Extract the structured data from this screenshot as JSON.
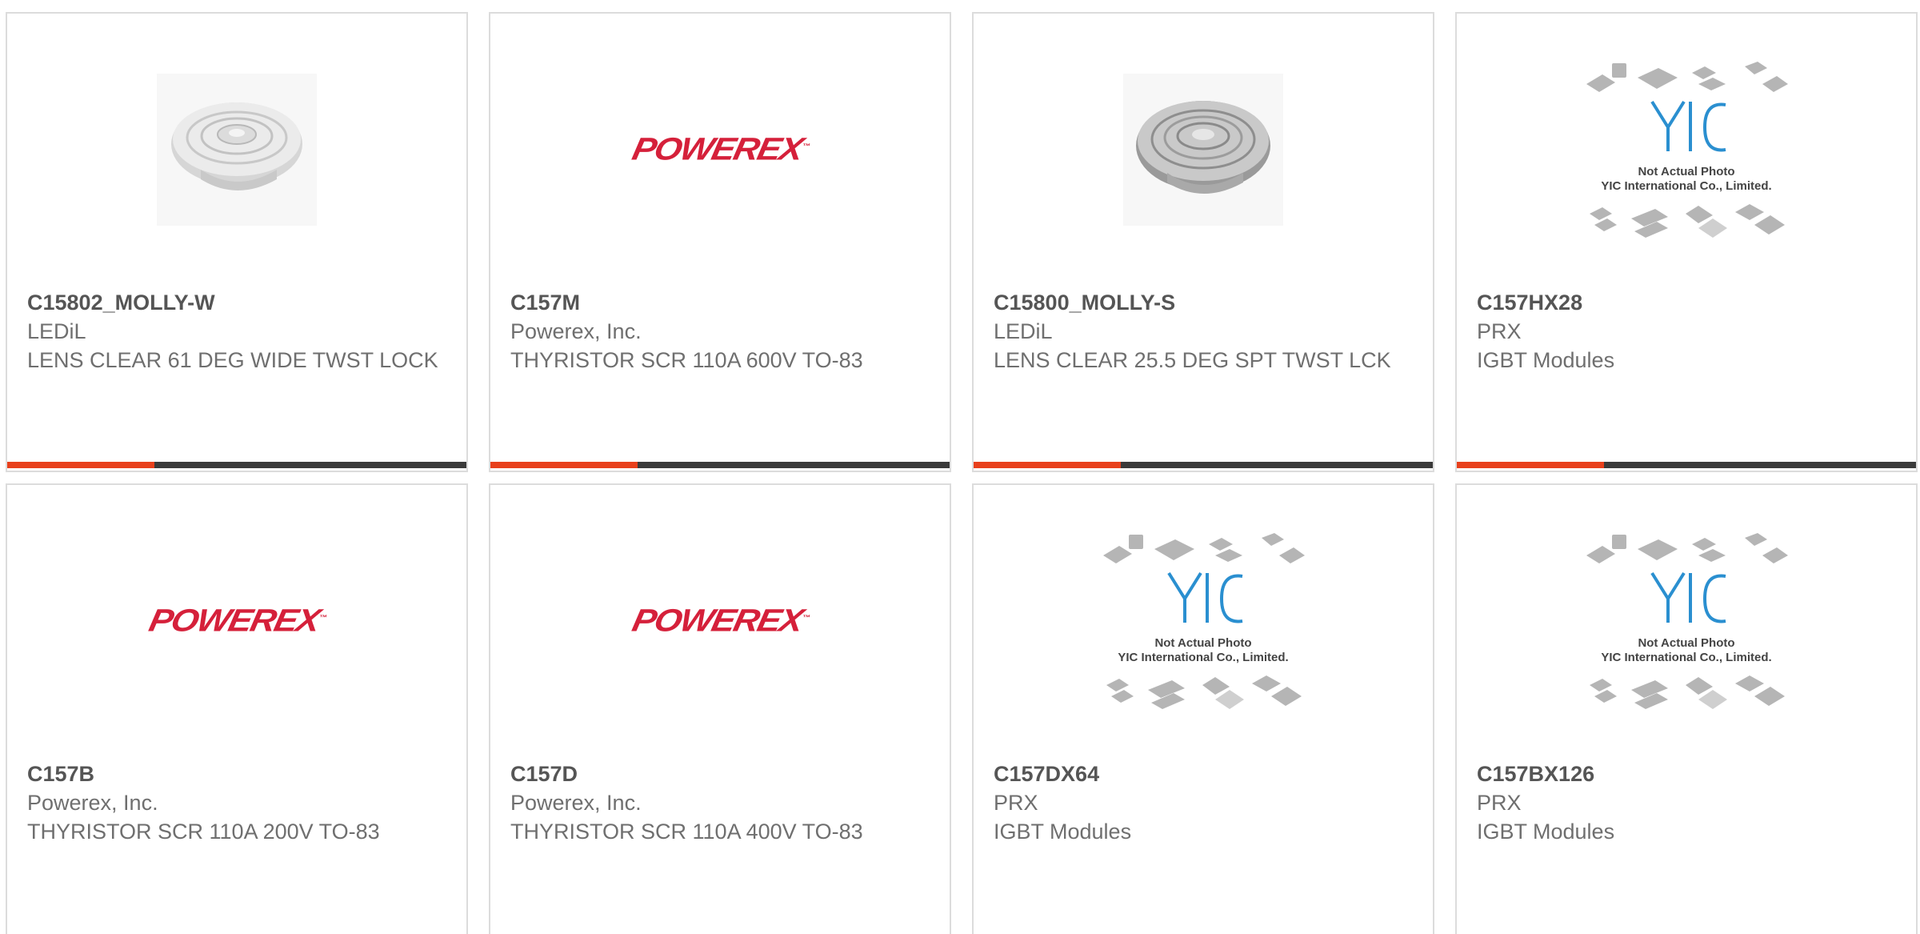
{
  "products": [
    {
      "part": "C15802_MOLLY-W",
      "manufacturer": "LEDiL",
      "description": "LENS CLEAR 61 DEG WIDE TWST LOCK",
      "image": "lens-wide-photo"
    },
    {
      "part": "C157M",
      "manufacturer": "Powerex, Inc.",
      "description": "THYRISTOR SCR 110A 600V TO-83",
      "image": "powerex-logo"
    },
    {
      "part": "C15800_MOLLY-S",
      "manufacturer": "LEDiL",
      "description": "LENS CLEAR 25.5 DEG SPT TWST LCK",
      "image": "lens-spot-photo"
    },
    {
      "part": "C157HX28",
      "manufacturer": "PRX",
      "description": "IGBT Modules",
      "image": "yic-placeholder"
    },
    {
      "part": "C157B",
      "manufacturer": "Powerex, Inc.",
      "description": "THYRISTOR SCR 110A 200V TO-83",
      "image": "powerex-logo"
    },
    {
      "part": "C157D",
      "manufacturer": "Powerex, Inc.",
      "description": "THYRISTOR SCR 110A 400V TO-83",
      "image": "powerex-logo"
    },
    {
      "part": "C157DX64",
      "manufacturer": "PRX",
      "description": "IGBT Modules",
      "image": "yic-placeholder"
    },
    {
      "part": "C157BX126",
      "manufacturer": "PRX",
      "description": "IGBT Modules",
      "image": "yic-placeholder"
    }
  ],
  "logos": {
    "powerex": "POWEREX",
    "yic_line1": "Not Actual Photo",
    "yic_line2": "YIC International Co., Limited."
  },
  "colors": {
    "accent": "#e8401c",
    "bar": "#3a3a3a",
    "powerex_red": "#d5203a",
    "yic_blue": "#2a8fd0"
  }
}
